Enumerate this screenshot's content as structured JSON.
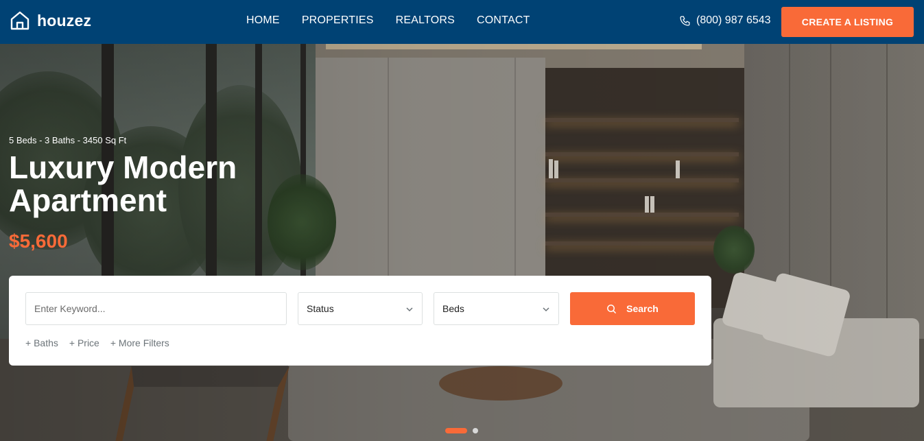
{
  "brand": {
    "name": "houzez",
    "icon": "home-outline-icon"
  },
  "nav": [
    {
      "label": "HOME"
    },
    {
      "label": "PROPERTIES"
    },
    {
      "label": "REALTORS"
    },
    {
      "label": "CONTACT"
    }
  ],
  "header": {
    "phone": "(800) 987 6543",
    "phone_icon": "phone-icon",
    "cta_label": "CREATE A LISTING"
  },
  "hero": {
    "meta": "5 Beds - 3 Baths - 3450 Sq Ft",
    "title": "Luxury Modern Apartment",
    "price": "$5,600"
  },
  "search": {
    "keyword_placeholder": "Enter Keyword...",
    "status_value": "Status",
    "beds_value": "Beds",
    "button_label": "Search",
    "filters": [
      "+ Baths",
      "+ Price",
      "+ More Filters"
    ]
  },
  "slider": {
    "count": 2,
    "active": 1
  },
  "colors": {
    "header_bg": "#004274",
    "accent": "#f96a38",
    "card_bg": "#ffffff"
  }
}
